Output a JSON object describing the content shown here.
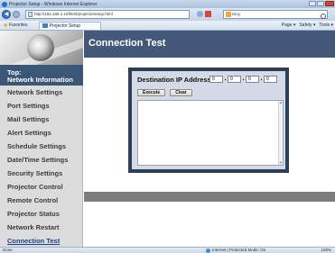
{
  "window": {
    "title": "Projector Setup - Windows Internet Explorer"
  },
  "address_bar": {
    "url": "http://192.168.1.10/html/projectorsetup.html",
    "search_placeholder": "Bing"
  },
  "favorites_bar": {
    "favorites_label": "Favorites",
    "tab_label": "Projector Setup",
    "commands": [
      "Page ▾",
      "Safety ▾",
      "Tools ▾"
    ]
  },
  "sidebar": {
    "top_line1": "Top:",
    "top_line2": "Network Information",
    "items": [
      {
        "label": "Network Settings"
      },
      {
        "label": "Port Settings"
      },
      {
        "label": "Mail Settings"
      },
      {
        "label": "Alert Settings"
      },
      {
        "label": "Schedule Settings"
      },
      {
        "label": "Date/Time Settings"
      },
      {
        "label": "Security Settings"
      },
      {
        "label": "Projector Control"
      },
      {
        "label": "Remote Control"
      },
      {
        "label": "Projector Status"
      },
      {
        "label": "Network Restart"
      },
      {
        "label": "Connection Test"
      }
    ]
  },
  "main": {
    "page_title": "Connection Test",
    "dialog": {
      "ip_label": "Destination IP Address",
      "octets": [
        "0",
        "0",
        "0",
        "0"
      ],
      "execute_label": "Execute",
      "clear_label": "Clear"
    }
  },
  "status_bar": {
    "status": "Done",
    "zone": "Internet | Protected Mode: On",
    "zoom": "100%"
  }
}
